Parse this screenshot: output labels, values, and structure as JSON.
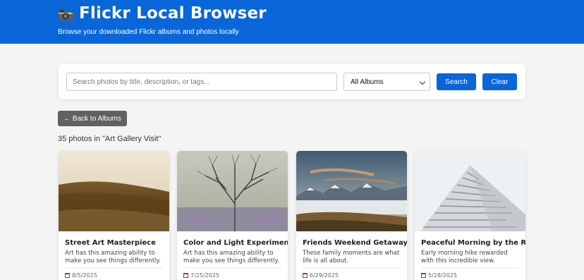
{
  "header": {
    "title": "Flickr Local Browser",
    "subtitle": "Browse your downloaded Flickr albums and photos locally",
    "icon": "camera-icon"
  },
  "search": {
    "placeholder": "Search photos by title, description, or tags...",
    "value": "",
    "album_selected": "All Albums",
    "search_label": "Search",
    "clear_label": "Clear"
  },
  "nav": {
    "back_label": "← Back to Albums"
  },
  "gallery": {
    "count_text": "35 photos in \"Art Gallery Visit\"",
    "photos": [
      {
        "title": "Street Art Masterpiece",
        "description": "Art has this amazing ability to make you see things differently.",
        "date": "8/5/2025"
      },
      {
        "title": "Color and Light Experiment",
        "description": "Art has this amazing ability to make you see things differently.",
        "date": "7/25/2025"
      },
      {
        "title": "Friends Weekend Getaway",
        "description": "These family moments are what life is all about.",
        "date": "6/29/2025"
      },
      {
        "title": "Peaceful Morning by the River",
        "description": "Early morning hike rewarded with this incredible view.",
        "date": "5/28/2025"
      }
    ]
  },
  "colors": {
    "header_bg": "#0866d9",
    "primary_button": "#0866d9",
    "back_button": "#616161"
  }
}
